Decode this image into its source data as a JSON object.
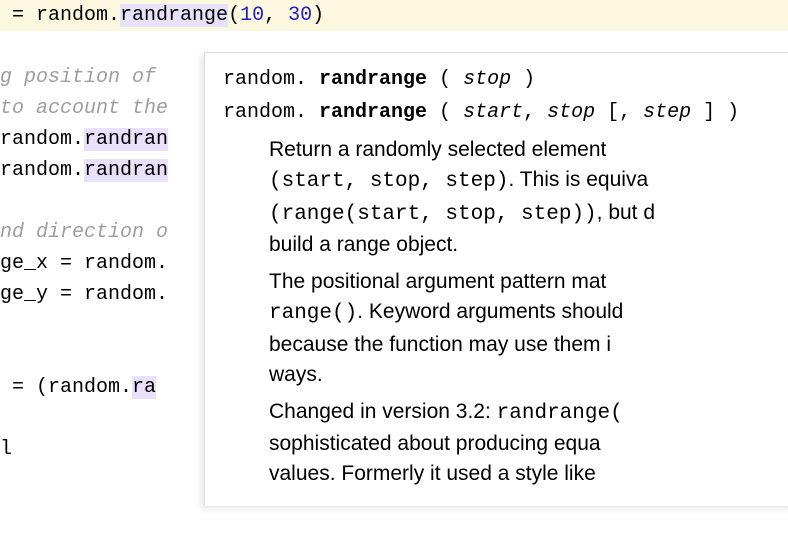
{
  "code": {
    "line1_prefix": " = random.",
    "line1_fn": "randrange",
    "line1_open": "(",
    "line1_arg1": "10",
    "line1_sep": ", ",
    "line1_arg2": "30",
    "line1_close": ")",
    "comment1": "g position of ",
    "comment2": "to account the ",
    "line4_a": "random.",
    "line4_b": "randran",
    "line5_a": "random.",
    "line5_b": "randran",
    "comment3": "nd direction o",
    "line8": "ge_x = random.",
    "line9": "ge_y = random.",
    "line12_a": " = (random.",
    "line12_b": "ra",
    "line15": "l"
  },
  "tooltip": {
    "sig1_mod": "random. ",
    "sig1_fn": "randrange",
    "sig1_rest": " ( stop )",
    "sig2_mod": "random. ",
    "sig2_fn": "randrange",
    "sig2_rest": " ( start, stop [, step ] )",
    "p1_a": "Return a randomly selected element ",
    "p1_b": "(start, stop, step)",
    "p1_c": ". This is equiva",
    "p1_d": "(range(start, stop, step))",
    "p1_e": ", but d",
    "p1_f": "build a range object.",
    "p2_a": "The positional argument pattern mat",
    "p2_b": "range()",
    "p2_c": ". Keyword arguments should",
    "p2_d": "because the function may use them i",
    "p2_e": "ways.",
    "p3_a": "Changed in version 3.2: ",
    "p3_b": "randrange(",
    "p3_c": "sophisticated about producing equa",
    "p3_d": "values. Formerly it used a style like "
  }
}
